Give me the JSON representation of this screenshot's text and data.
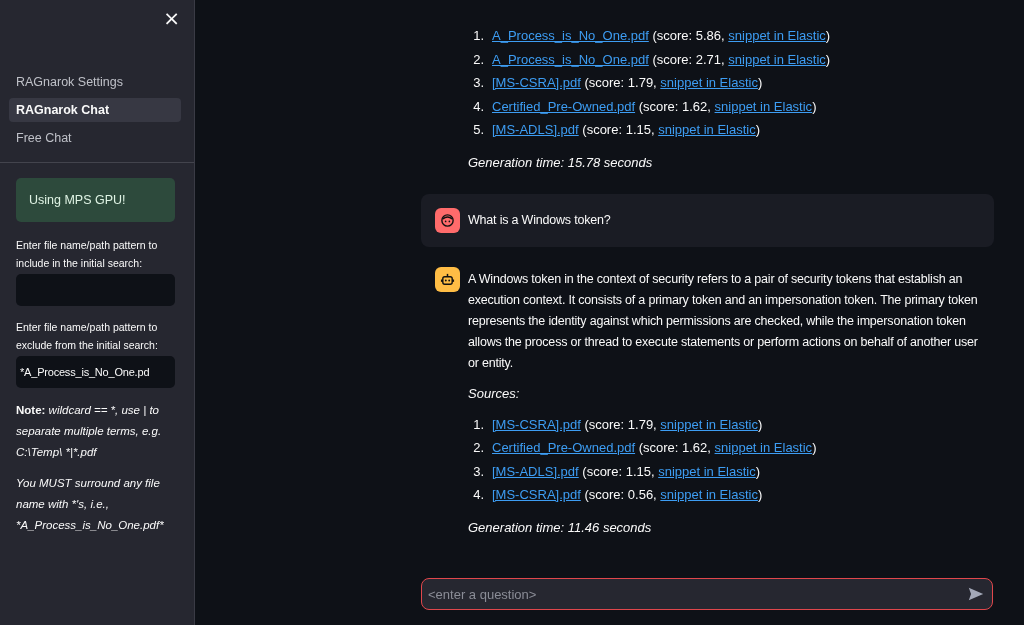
{
  "sidebar": {
    "close": "×",
    "nav": [
      {
        "label": "RAGnarok Settings",
        "selected": false
      },
      {
        "label": "RAGnarok Chat",
        "selected": true
      },
      {
        "label": "Free Chat",
        "selected": false
      }
    ],
    "alert": "Using MPS GPU!",
    "include_label": "Enter file name/path pattern to include in the initial search:",
    "exclude_label": "Enter file name/path pattern to exclude from the initial search:",
    "exclude_value": "*A_Process_is_No_One.pd",
    "note_label": "Note:",
    "note_text": "wildcard == *, use | to separate multiple terms, e.g. C:\\Temp\\ *|*.pdf",
    "hint": "You MUST surround any file name with *'s, i.e., *A_Process_is_No_One.pdf*"
  },
  "messages": [
    {
      "kind": "assistant",
      "sources": [
        {
          "number": "1.",
          "file": "A_Process_is_No_One.pdf",
          "score": "(score: 5.86,",
          "link": "snippet in Elastic",
          "tail": ")"
        },
        {
          "number": "2.",
          "file": "A_Process_is_No_One.pdf",
          "score": "(score: 2.71,",
          "link": "snippet in Elastic",
          "tail": ")"
        },
        {
          "number": "3.",
          "file": "[MS-CSRA].pdf",
          "score": "(score: 1.79,",
          "link": "snippet in Elastic",
          "tail": ")"
        },
        {
          "number": "4.",
          "file": "Certified_Pre-Owned.pdf",
          "score": "(score: 1.62,",
          "link": "snippet in Elastic",
          "tail": ")"
        },
        {
          "number": "5.",
          "file": "[MS-ADLS].pdf",
          "score": "(score: 1.15,",
          "link": "snippet in Elastic",
          "tail": ")"
        }
      ],
      "generation_time": "Generation time: 15.78 seconds"
    },
    {
      "kind": "user",
      "text": "What is a Windows token?"
    },
    {
      "kind": "assistant",
      "text": "A Windows token in the context of security refers to a pair of security tokens that establish an execution context. It consists of a primary token and an impersonation token. The primary token represents the identity against which permissions are checked, while the impersonation token allows the process or thread to execute statements or perform actions on behalf of another user or entity.",
      "sources_label": "Sources:",
      "sources": [
        {
          "number": "1.",
          "file": "[MS-CSRA].pdf",
          "score": "(score: 1.79,",
          "link": "snippet in Elastic",
          "tail": ")"
        },
        {
          "number": "2.",
          "file": "Certified_Pre-Owned.pdf",
          "score": "(score: 1.62,",
          "link": "snippet in Elastic",
          "tail": ")"
        },
        {
          "number": "3.",
          "file": "[MS-ADLS].pdf",
          "score": "(score: 1.15,",
          "link": "snippet in Elastic",
          "tail": ")"
        },
        {
          "number": "4.",
          "file": "[MS-CSRA].pdf",
          "score": "(score: 0.56,",
          "link": "snippet in Elastic",
          "tail": ")"
        }
      ],
      "generation_time": "Generation time: 11.46 seconds"
    }
  ],
  "chat_input": {
    "placeholder": "<enter a question>"
  }
}
